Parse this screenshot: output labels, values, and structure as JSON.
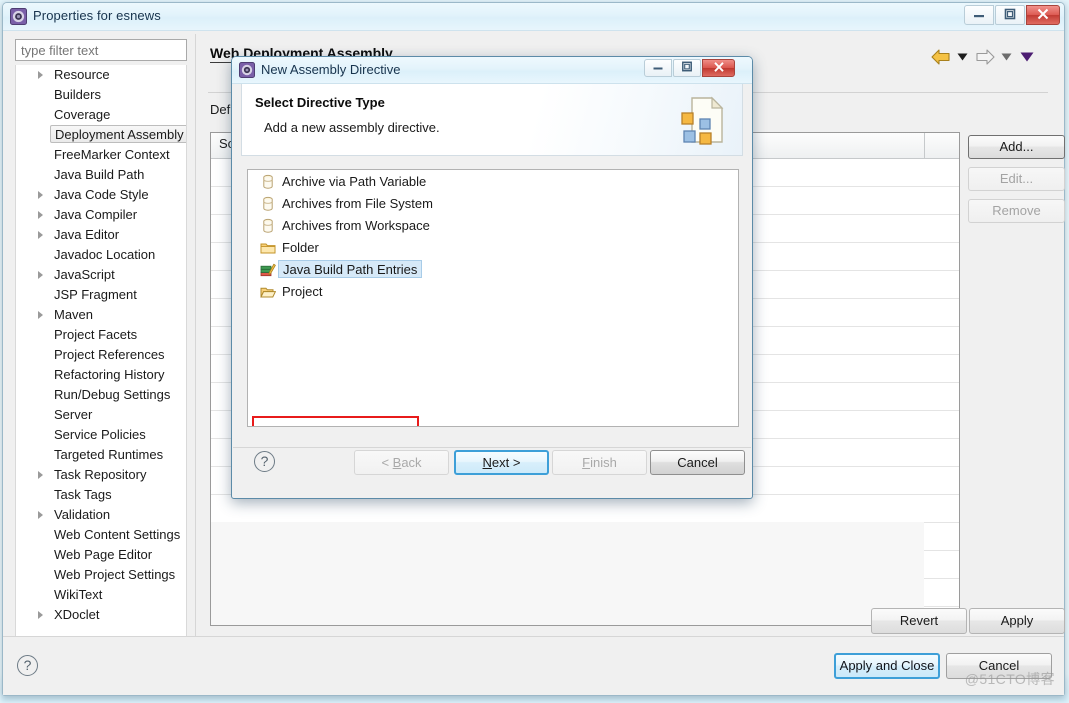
{
  "window": {
    "title": "Properties for esnews",
    "icon": "eclipse-properties-icon",
    "minimize_label": "–",
    "maximize_label": "□",
    "close_label": "✕"
  },
  "filter": {
    "placeholder": "type filter text",
    "value": ""
  },
  "tree": {
    "items": [
      {
        "label": "Resource",
        "expandable": true,
        "selected": false
      },
      {
        "label": "Builders",
        "expandable": false,
        "selected": false
      },
      {
        "label": "Coverage",
        "expandable": false,
        "selected": false
      },
      {
        "label": "Deployment Assembly",
        "expandable": false,
        "selected": true
      },
      {
        "label": "FreeMarker Context",
        "expandable": false,
        "selected": false
      },
      {
        "label": "Java Build Path",
        "expandable": false,
        "selected": false
      },
      {
        "label": "Java Code Style",
        "expandable": true,
        "selected": false
      },
      {
        "label": "Java Compiler",
        "expandable": true,
        "selected": false
      },
      {
        "label": "Java Editor",
        "expandable": true,
        "selected": false
      },
      {
        "label": "Javadoc Location",
        "expandable": false,
        "selected": false
      },
      {
        "label": "JavaScript",
        "expandable": true,
        "selected": false
      },
      {
        "label": "JSP Fragment",
        "expandable": false,
        "selected": false
      },
      {
        "label": "Maven",
        "expandable": true,
        "selected": false
      },
      {
        "label": "Project Facets",
        "expandable": false,
        "selected": false
      },
      {
        "label": "Project References",
        "expandable": false,
        "selected": false
      },
      {
        "label": "Refactoring History",
        "expandable": false,
        "selected": false
      },
      {
        "label": "Run/Debug Settings",
        "expandable": false,
        "selected": false
      },
      {
        "label": "Server",
        "expandable": false,
        "selected": false
      },
      {
        "label": "Service Policies",
        "expandable": false,
        "selected": false
      },
      {
        "label": "Targeted Runtimes",
        "expandable": false,
        "selected": false
      },
      {
        "label": "Task Repository",
        "expandable": true,
        "selected": false
      },
      {
        "label": "Task Tags",
        "expandable": false,
        "selected": false
      },
      {
        "label": "Validation",
        "expandable": true,
        "selected": false
      },
      {
        "label": "Web Content Settings",
        "expandable": false,
        "selected": false
      },
      {
        "label": "Web Page Editor",
        "expandable": false,
        "selected": false
      },
      {
        "label": "Web Project Settings",
        "expandable": false,
        "selected": false
      },
      {
        "label": "WikiText",
        "expandable": false,
        "selected": false
      },
      {
        "label": "XDoclet",
        "expandable": true,
        "selected": false
      }
    ]
  },
  "page": {
    "title": "Web Deployment Assembly",
    "description_partial": "Def",
    "table": {
      "columns": [
        "So"
      ],
      "rows": []
    },
    "buttons": {
      "add": "Add...",
      "edit": "Edit...",
      "remove": "Remove",
      "revert": "Revert",
      "apply": "Apply"
    },
    "nav": {
      "back_icon": "back-arrow-icon",
      "back_menu_icon": "caret-down-icon",
      "forward_icon": "forward-arrow-icon",
      "forward_menu_icon": "caret-down-icon",
      "more_icon": "caret-down-icon"
    }
  },
  "footer": {
    "help_label": "?",
    "apply_and_close": "Apply and Close",
    "cancel": "Cancel",
    "watermark": "@51CTO博客"
  },
  "wizard": {
    "title": "New Assembly Directive",
    "icon": "eclipse-wizard-icon",
    "minimize_label": "–",
    "maximize_label": "□",
    "close_label": "✕",
    "banner": {
      "heading": "Select Directive Type",
      "subtext": "Add a new assembly directive.",
      "image": "assembly-document-icon"
    },
    "list": [
      {
        "label": "Archive via Path Variable",
        "icon": "jar-archive-icon",
        "highlighted": false
      },
      {
        "label": "Archives from File System",
        "icon": "jar-archive-icon",
        "highlighted": false
      },
      {
        "label": "Archives from Workspace",
        "icon": "jar-archive-icon",
        "highlighted": false
      },
      {
        "label": "Folder",
        "icon": "folder-icon",
        "highlighted": false
      },
      {
        "label": "Java Build Path Entries",
        "icon": "java-build-path-icon",
        "highlighted": true
      },
      {
        "label": "Project",
        "icon": "open-folder-icon",
        "highlighted": false
      }
    ],
    "annotation": {
      "type": "red-highlight-box",
      "target": "Java Build Path Entries"
    },
    "buttons": {
      "help": "?",
      "back": {
        "prefix": "< ",
        "mnemonic": "B",
        "rest": "ack",
        "enabled": false
      },
      "next": {
        "prefix": "",
        "mnemonic": "N",
        "rest": "ext >",
        "enabled": true,
        "default": true
      },
      "finish": {
        "prefix": "",
        "mnemonic": "F",
        "rest": "inish",
        "enabled": false
      },
      "cancel": {
        "label": "Cancel",
        "enabled": true
      }
    }
  },
  "colors": {
    "accent_blue": "#3d9fd8",
    "highlight_red": "#e81b1b",
    "selection_blue": "#d6e9f8",
    "titlebar": "#e3f3fb",
    "panel_bg": "#f0f0f0",
    "close_red": "#c23b33"
  }
}
